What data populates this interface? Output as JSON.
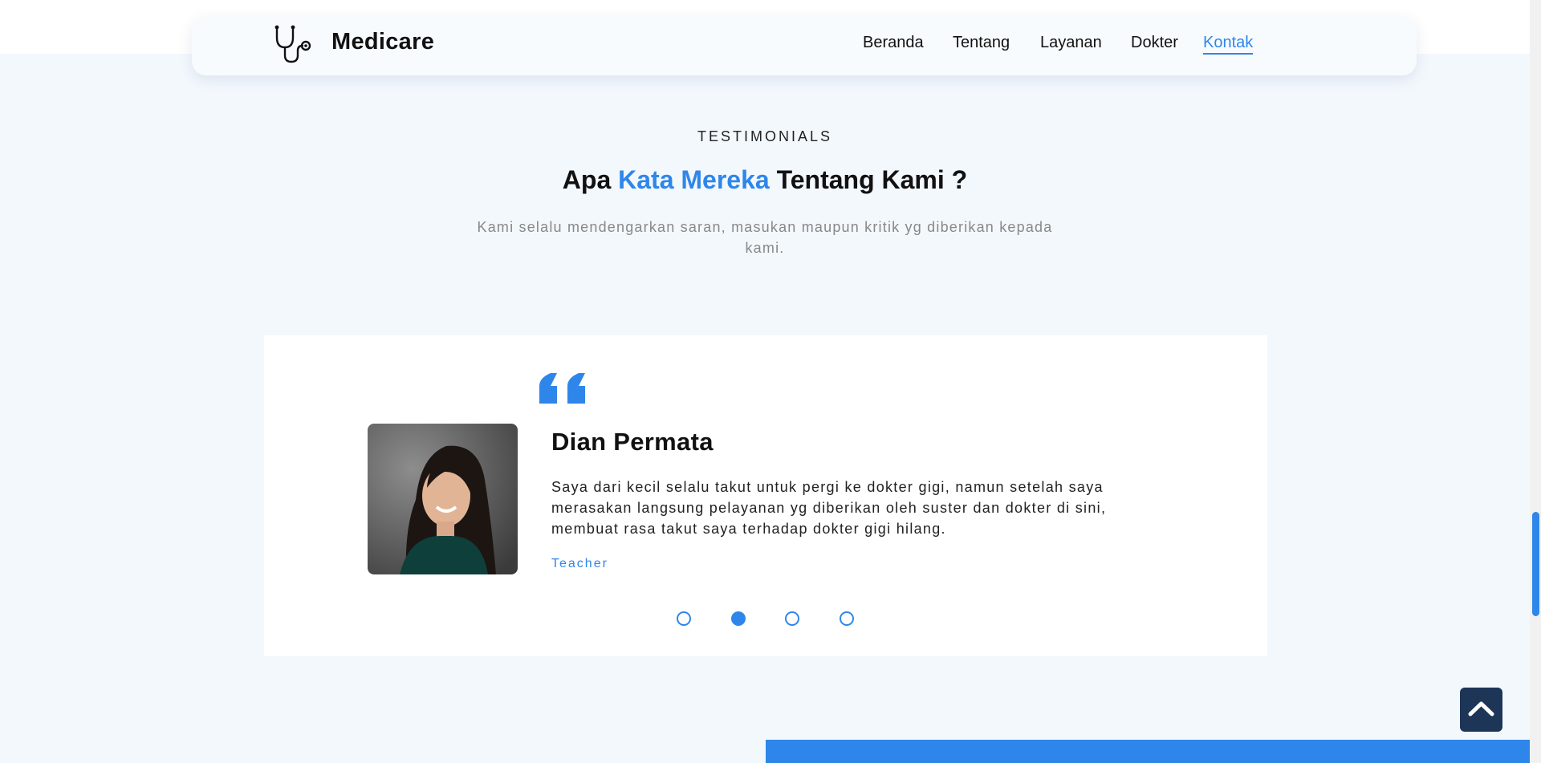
{
  "brand": {
    "name": "Medicare",
    "icon": "stethoscope-icon"
  },
  "nav": {
    "items": [
      "Beranda",
      "Tentang",
      "Layanan",
      "Dokter",
      "Kontak"
    ],
    "active": "Kontak"
  },
  "section": {
    "eyebrow": "TESTIMONIALS",
    "heading_pre": "Apa ",
    "heading_highlight": "Kata Mereka",
    "heading_post": " Tentang Kami ?",
    "subtext": "Kami selalu mendengarkan saran, masukan maupun kritik yg diberikan kepada kami."
  },
  "testimonial": {
    "quote_icon": "quote-icon",
    "name": "Dian Permata",
    "text": "Saya dari kecil selalu takut untuk pergi ke dokter gigi, namun setelah saya merasakan langsung pelayanan yg diberikan oleh suster dan dokter di sini, membuat rasa takut saya terhadap dokter gigi hilang.",
    "role": "Teacher"
  },
  "carousel": {
    "slide_count": 4,
    "active_index": 1
  },
  "colors": {
    "accent": "#2f86ea",
    "navy": "#1d3557",
    "section_bg": "#f3f8fd"
  },
  "scroll_top_icon": "chevron-up-icon"
}
